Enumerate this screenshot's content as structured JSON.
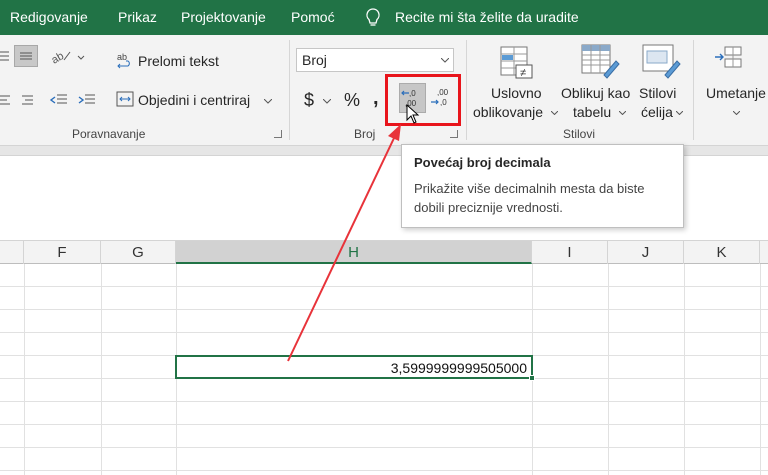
{
  "menubar": {
    "items": [
      "Redigovanje",
      "Prikaz",
      "Projektovanje",
      "Pomoć"
    ],
    "tell_me": "Recite mi šta želite da uradite"
  },
  "ribbon": {
    "alignment": {
      "wrap_text": "Prelomi tekst",
      "merge_center": "Objedini i centriraj",
      "label": "Poravnavanje"
    },
    "number": {
      "format_value": "Broj",
      "currency": "$",
      "percent": "%",
      "comma": ",",
      "label": "Broj"
    },
    "styles": {
      "conditional_1": "Uslovno",
      "conditional_2": "oblikovanje",
      "format_table_1": "Oblikuj kao",
      "format_table_2": "tabelu",
      "cell_styles_1": "Stilovi",
      "cell_styles_2": "ćelija",
      "label": "Stilovi"
    },
    "cells": {
      "insert": "Umetanje"
    }
  },
  "tooltip": {
    "title": "Povećaj broj decimala",
    "body": "Prikažite više decimalnih mesta da biste dobili preciznije vrednosti."
  },
  "sheet": {
    "columns": [
      "F",
      "G",
      "H",
      "I",
      "J",
      "K"
    ],
    "active_cell_value": "3,5999999999505000"
  },
  "colors": {
    "accent": "#217346",
    "highlight": "#e8141b",
    "arrow": "#e8333a"
  }
}
